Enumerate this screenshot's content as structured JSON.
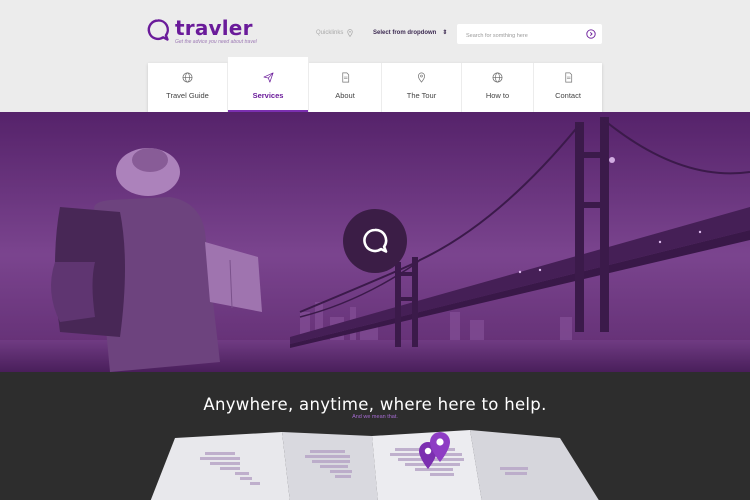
{
  "brand": {
    "name": "travler",
    "tagline": "Get the advice you need about travel",
    "accent_color": "#6a1b9a"
  },
  "header": {
    "quicklinks_label": "Quicklinks",
    "dropdown_label": "Select from dropdown",
    "search_placeholder": "Search for somthing here"
  },
  "nav": {
    "items": [
      {
        "label": "Travel Guide",
        "icon": "globe-icon"
      },
      {
        "label": "Services",
        "icon": "paper-plane-icon",
        "active": true
      },
      {
        "label": "About",
        "icon": "document-icon"
      },
      {
        "label": "The Tour",
        "icon": "map-pin-icon"
      },
      {
        "label": "How to",
        "icon": "globe-icon"
      },
      {
        "label": "Contact",
        "icon": "document-icon"
      }
    ]
  },
  "hero": {
    "icon": "chat-bubble-icon"
  },
  "section": {
    "headline": "Anywhere, anytime, where here to help.",
    "subline": "And we mean that."
  }
}
